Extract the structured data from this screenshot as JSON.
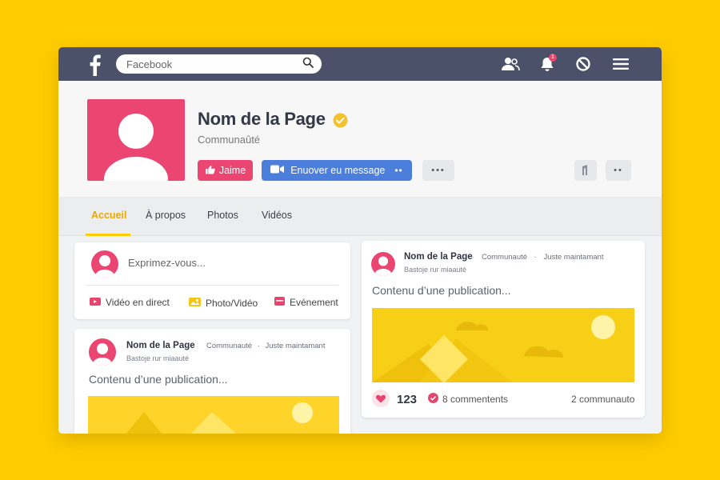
{
  "topbar": {
    "search_placeholder": "Facebook",
    "notification_count": "1"
  },
  "page": {
    "name": "Nom de la Page",
    "category": "Communaûté",
    "verified_color": "#F2C230",
    "like_label": "Jaime",
    "message_label": "Enuover eu message"
  },
  "tabs": [
    {
      "label": "Accueil",
      "active": true
    },
    {
      "label": "À propos"
    },
    {
      "label": "Photos"
    },
    {
      "label": "Vidéos"
    }
  ],
  "composer": {
    "prompt": "Exprimez-vous...",
    "actions": [
      "Vidéo en direct",
      "Photo/Vidéo",
      "Evénement"
    ]
  },
  "posts": [
    {
      "author": "Nom de la Page",
      "category": "Communauté",
      "separator": "·",
      "time": "Juste maintamant",
      "subtitle": "Bastoje rur miaauté",
      "content": "Contenu d’une publication..."
    },
    {
      "author": "Nom de la Page",
      "category": "Communauté",
      "separator": "·",
      "time": "Juste maintamant",
      "subtitle": "Bastoje rur miaauté",
      "content": "Contenu d’une publication...",
      "likes": "123",
      "comments": "8 commentents",
      "shares": "2 communauto"
    }
  ],
  "colors": {
    "accent": "#FFCC00",
    "brand_pink": "#EB4572",
    "topbar": "#4A5169",
    "message_blue": "#4C7EDB"
  }
}
